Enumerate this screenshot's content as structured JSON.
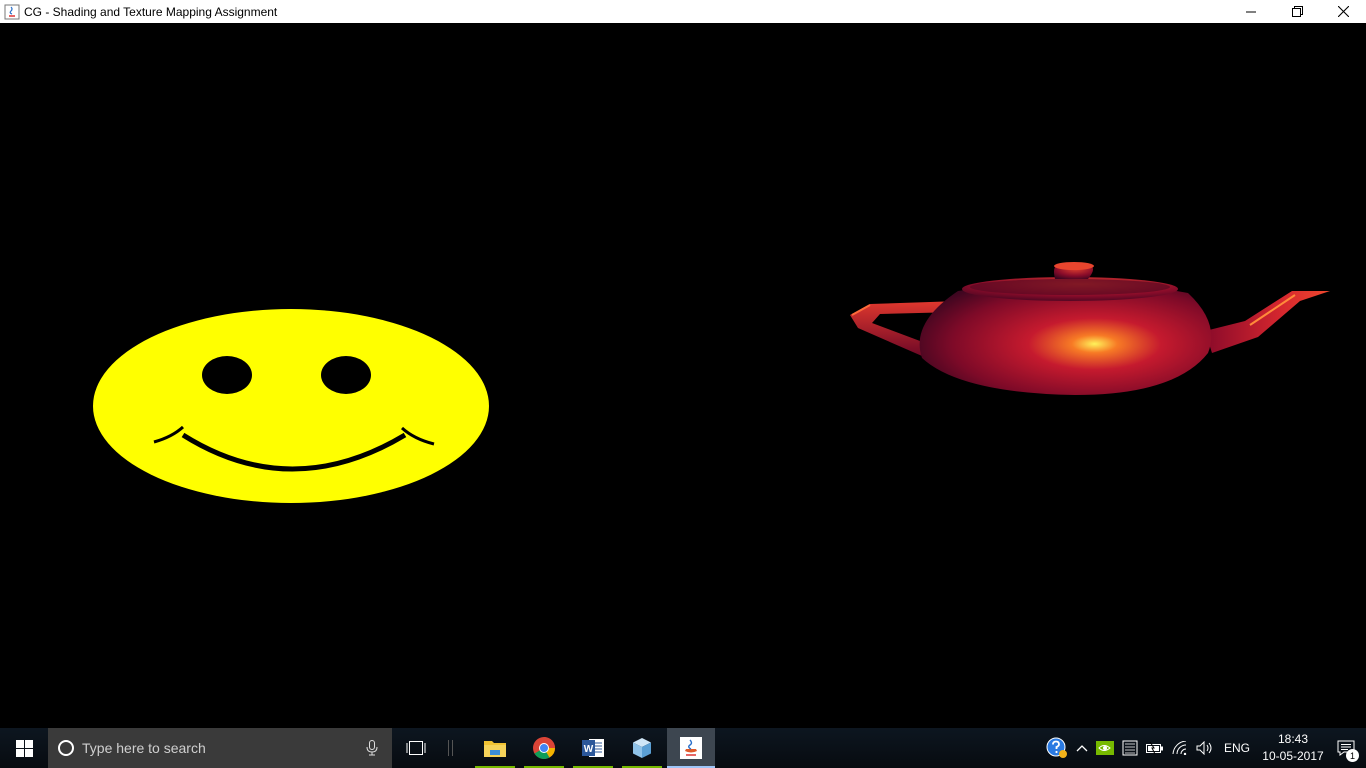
{
  "window": {
    "title": "CG - Shading and Texture Mapping Assignment",
    "controls": {
      "minimize": "—",
      "restore": "❐",
      "close": "✕"
    }
  },
  "scene": {
    "background": "#000000",
    "objects": [
      {
        "name": "smiley-face",
        "color": "#ffff00"
      },
      {
        "name": "utah-teapot",
        "color": "#a0102a"
      }
    ]
  },
  "taskbar": {
    "search": {
      "placeholder": "Type here to search"
    },
    "apps": [
      {
        "name": "file-explorer",
        "icon": "folder-icon"
      },
      {
        "name": "google-chrome",
        "icon": "chrome-icon"
      },
      {
        "name": "microsoft-word",
        "icon": "word-icon",
        "letter": "W"
      },
      {
        "name": "virtualbox",
        "icon": "cube-icon"
      },
      {
        "name": "java",
        "icon": "java-icon",
        "active": true
      }
    ],
    "tray": {
      "language": "ENG",
      "time": "18:43",
      "date": "10-05-2017",
      "notification_count": "1"
    }
  }
}
